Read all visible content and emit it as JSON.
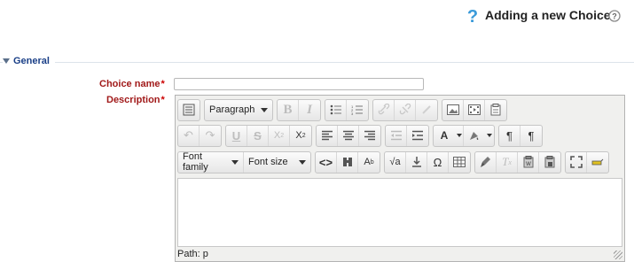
{
  "header": {
    "title": "Adding a new Choice",
    "help_icon": "question-mark-icon",
    "help_color": "#3a9ad9"
  },
  "fieldset": {
    "legend": "General"
  },
  "form": {
    "choice_name_label": "Choice name",
    "choice_name_value": "",
    "description_label": "Description",
    "required_marker": "*"
  },
  "editor": {
    "block_format": "Paragraph",
    "font_family": "Font family",
    "font_size": "Font size",
    "path_label": "Path: p",
    "toolbar_row1": [
      "toolbar-toggle",
      "bold",
      "italic",
      "bullet-list",
      "numbered-list",
      "link",
      "unlink",
      "anchor",
      "image",
      "media",
      "paste-text"
    ],
    "toolbar_row2": [
      "undo",
      "redo",
      "underline",
      "strikethrough",
      "subscript",
      "superscript",
      "align-left",
      "align-center",
      "align-right",
      "outdent",
      "indent",
      "text-color",
      "background-color",
      "ltr",
      "rtl"
    ],
    "toolbar_row3": [
      "html-source",
      "find",
      "replace",
      "equation",
      "insert-file",
      "special-char",
      "table",
      "clean",
      "remove-format",
      "paste-word",
      "paste-plain",
      "fullscreen",
      "spellcheck"
    ]
  },
  "colors": {
    "label": "#a11a1a",
    "legend": "#1a3f87",
    "required": "#cc0000"
  }
}
